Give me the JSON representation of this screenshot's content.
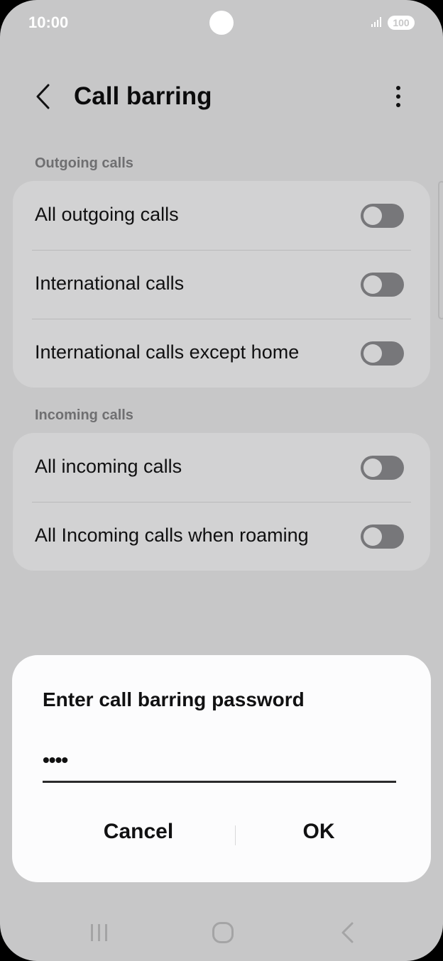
{
  "status": {
    "time": "10:00",
    "battery": "100"
  },
  "appbar": {
    "title": "Call barring"
  },
  "outgoing": {
    "header": "Outgoing calls",
    "items": [
      {
        "label": "All outgoing calls",
        "enabled": false
      },
      {
        "label": "International calls",
        "enabled": false
      },
      {
        "label": "International calls except home",
        "enabled": false
      }
    ]
  },
  "incoming": {
    "header": "Incoming calls",
    "items": [
      {
        "label": "All incoming calls",
        "enabled": false
      },
      {
        "label": "All Incoming calls when roaming",
        "enabled": false
      }
    ]
  },
  "dialog": {
    "title": "Enter call barring password",
    "password_value": "••••",
    "cancel_label": "Cancel",
    "ok_label": "OK"
  },
  "colors": {
    "background": "#c7c7c8",
    "card": "#d2d2d3",
    "toggle_off": "#77777a",
    "dialog": "#fcfcfd"
  }
}
